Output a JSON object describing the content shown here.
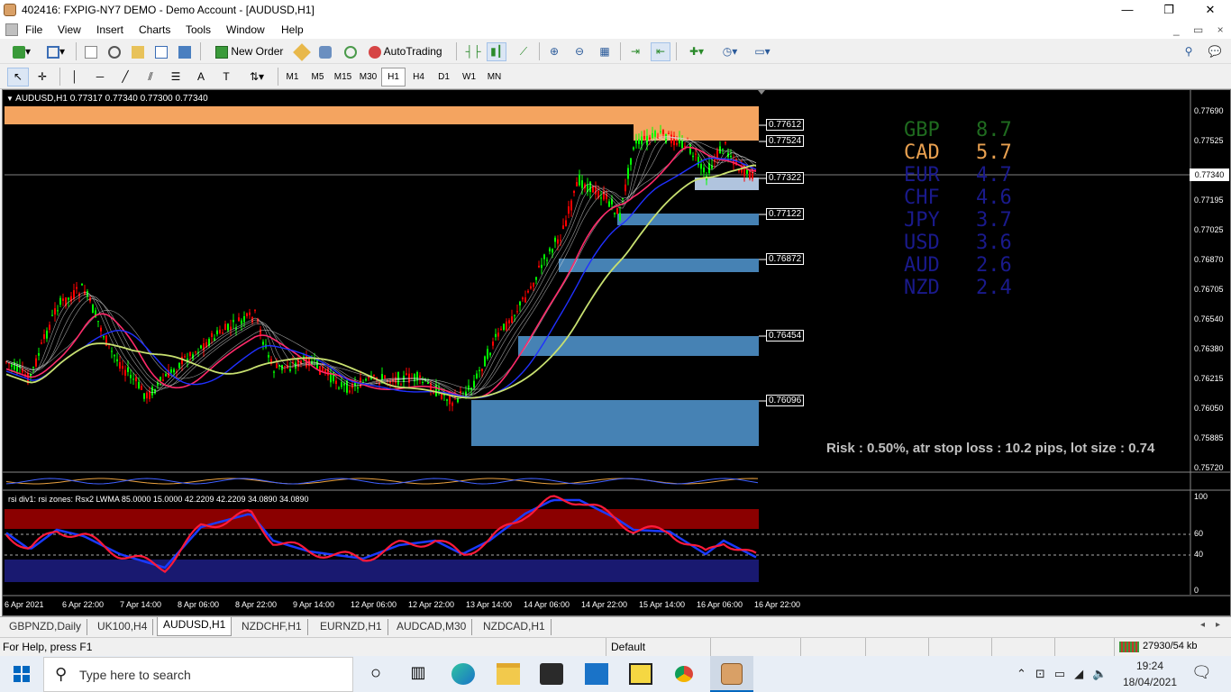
{
  "window": {
    "title": "402416: FXPIG-NY7 DEMO - Demo Account - [AUDUSD,H1]",
    "minimize": "—",
    "restore": "❐",
    "close": "✕",
    "inner_controls": "_ ▭ ×"
  },
  "menu": [
    "File",
    "View",
    "Insert",
    "Charts",
    "Tools",
    "Window",
    "Help"
  ],
  "toolbar": {
    "new_order": "New Order",
    "auto_trading": "AutoTrading"
  },
  "timeframes": [
    "M1",
    "M5",
    "M15",
    "M30",
    "H1",
    "H4",
    "D1",
    "W1",
    "MN"
  ],
  "active_timeframe": "H1",
  "chart": {
    "header": "AUDUSD,H1  0.77317 0.77340 0.77300 0.77340",
    "price_labels": [
      "0.77690",
      "0.77525",
      "0.77195",
      "0.77025",
      "0.76870",
      "0.76705",
      "0.76540",
      "0.76380",
      "0.76215",
      "0.76050",
      "0.75885",
      "0.75720"
    ],
    "current_price": "0.77340",
    "levels": [
      "0.77612",
      "0.77524",
      "0.77322",
      "0.77122",
      "0.76872",
      "0.76454",
      "0.76096"
    ],
    "date_labels": [
      "6 Apr 2021",
      "6 Apr 22:00",
      "7 Apr 14:00",
      "8 Apr 06:00",
      "8 Apr 22:00",
      "9 Apr 14:00",
      "12 Apr 06:00",
      "12 Apr 22:00",
      "13 Apr 14:00",
      "14 Apr 06:00",
      "14 Apr 22:00",
      "15 Apr 14:00",
      "16 Apr 06:00",
      "16 Apr 22:00"
    ],
    "strength": [
      {
        "ccy": "GBP",
        "val": "8.7",
        "color": "#1f6b1f"
      },
      {
        "ccy": "CAD",
        "val": "5.7",
        "color": "#e8a050"
      },
      {
        "ccy": "EUR",
        "val": "4.7",
        "color": "#1a1a8c"
      },
      {
        "ccy": "CHF",
        "val": "4.6",
        "color": "#1a1a8c"
      },
      {
        "ccy": "JPY",
        "val": "3.7",
        "color": "#1a1a8c"
      },
      {
        "ccy": "USD",
        "val": "3.6",
        "color": "#1a1a8c"
      },
      {
        "ccy": "AUD",
        "val": "2.6",
        "color": "#1a1a8c"
      },
      {
        "ccy": "NZD",
        "val": "2.4",
        "color": "#1a1a8c"
      }
    ],
    "risk_text": "Risk : 0.50%, atr stop loss : 10.2 pips, lot size : 0.74",
    "rsi_label": "rsi div1: rsi zones: Rsx2 LWMA 85.0000 15.0000 42.2209 42.2209 34.0890 34.0890",
    "rsi_scale": [
      "100",
      "60",
      "40",
      "0"
    ]
  },
  "tabs": [
    "GBPNZD,Daily",
    "UK100,H4",
    "AUDUSD,H1",
    "NZDCHF,H1",
    "EURNZD,H1",
    "AUDCAD,M30",
    "NZDCAD,H1"
  ],
  "active_tab": "AUDUSD,H1",
  "status": {
    "help": "For Help, press F1",
    "profile": "Default",
    "traffic": "27930/54 kb"
  },
  "taskbar": {
    "search_placeholder": "Type here to search",
    "time": "19:24",
    "date": "18/04/2021"
  },
  "colors": {
    "bull_candle": "#00ff00",
    "bear_candle": "#ff0000",
    "supply_zone": "#f4a460",
    "demand_zone": "#4682b4"
  }
}
